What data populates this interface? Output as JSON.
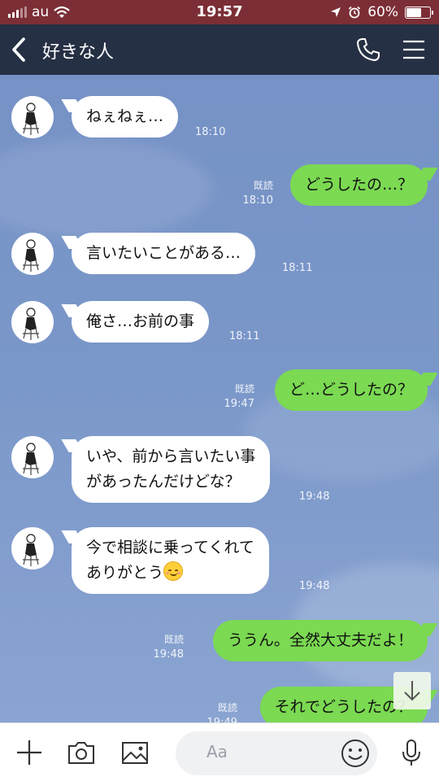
{
  "status_bar": {
    "carrier": "au",
    "time": "19:57",
    "battery": "60%",
    "battery_level": 0.6
  },
  "header": {
    "title": "好きな人"
  },
  "messages": [
    {
      "side": "recv",
      "text": "ねぇねぇ…",
      "time": "18:10"
    },
    {
      "side": "sent",
      "text": "どうしたの…？",
      "time": "18:10",
      "read": "既読"
    },
    {
      "side": "recv",
      "text": "言いたいことがある…",
      "time": "18:11"
    },
    {
      "side": "recv",
      "text": "俺さ…お前の事",
      "time": "18:11"
    },
    {
      "side": "sent",
      "text": "ど…どうしたの？",
      "time": "19:47",
      "read": "既読"
    },
    {
      "side": "recv",
      "lines": [
        "いや、前から言いたい事",
        "があったんだけどな？"
      ],
      "time": "19:48"
    },
    {
      "side": "recv",
      "lines": [
        "今で相談に乗ってくれて",
        "ありがとう"
      ],
      "emoji": "relieved-face",
      "time": "19:48"
    },
    {
      "side": "sent",
      "text": "ううん。全然大丈夫だよ！",
      "time": "19:48",
      "read": "既読"
    },
    {
      "side": "sent",
      "text": "それでどうしたの？",
      "time": "19:49",
      "read": "既読"
    }
  ],
  "input": {
    "placeholder": "Aa"
  },
  "icons": {
    "back": "back-chevron-icon",
    "call": "phone-icon",
    "menu": "hamburger-menu-icon",
    "plus": "plus-icon",
    "camera": "camera-icon",
    "image": "image-icon",
    "emoji": "smiley-icon",
    "mic": "microphone-icon",
    "scroll": "arrow-down-icon"
  },
  "colors": {
    "status_bar": "#7b2e36",
    "header": "#263044",
    "sent_bubble": "#7bd952",
    "recv_bubble": "#ffffff",
    "chat_background": "#7a97c9"
  }
}
